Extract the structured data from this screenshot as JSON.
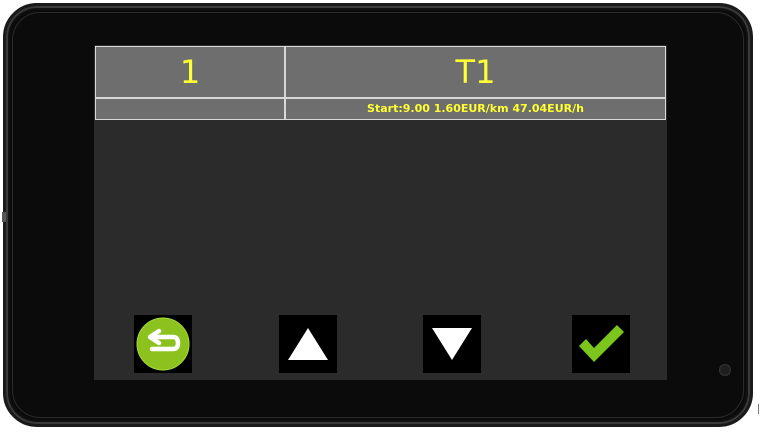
{
  "taximeter": {
    "index": "1",
    "tariff_name": "T1",
    "tariff_info": "Start:9.00 1.60EUR/km 47.04EUR/h"
  },
  "buttons": {
    "back": {
      "icon": "back-arrow-icon",
      "color": "#8cc21e"
    },
    "up": {
      "icon": "arrow-up-icon",
      "color": "#ffffff"
    },
    "down": {
      "icon": "arrow-down-icon",
      "color": "#ffffff"
    },
    "confirm": {
      "icon": "checkmark-icon",
      "color": "#7cc51d"
    }
  },
  "colors": {
    "text_accent": "#ffff33",
    "header_bg": "#6e6e6e",
    "screen_bg": "#2b2b2b",
    "device_bg": "#0b0b0b"
  }
}
